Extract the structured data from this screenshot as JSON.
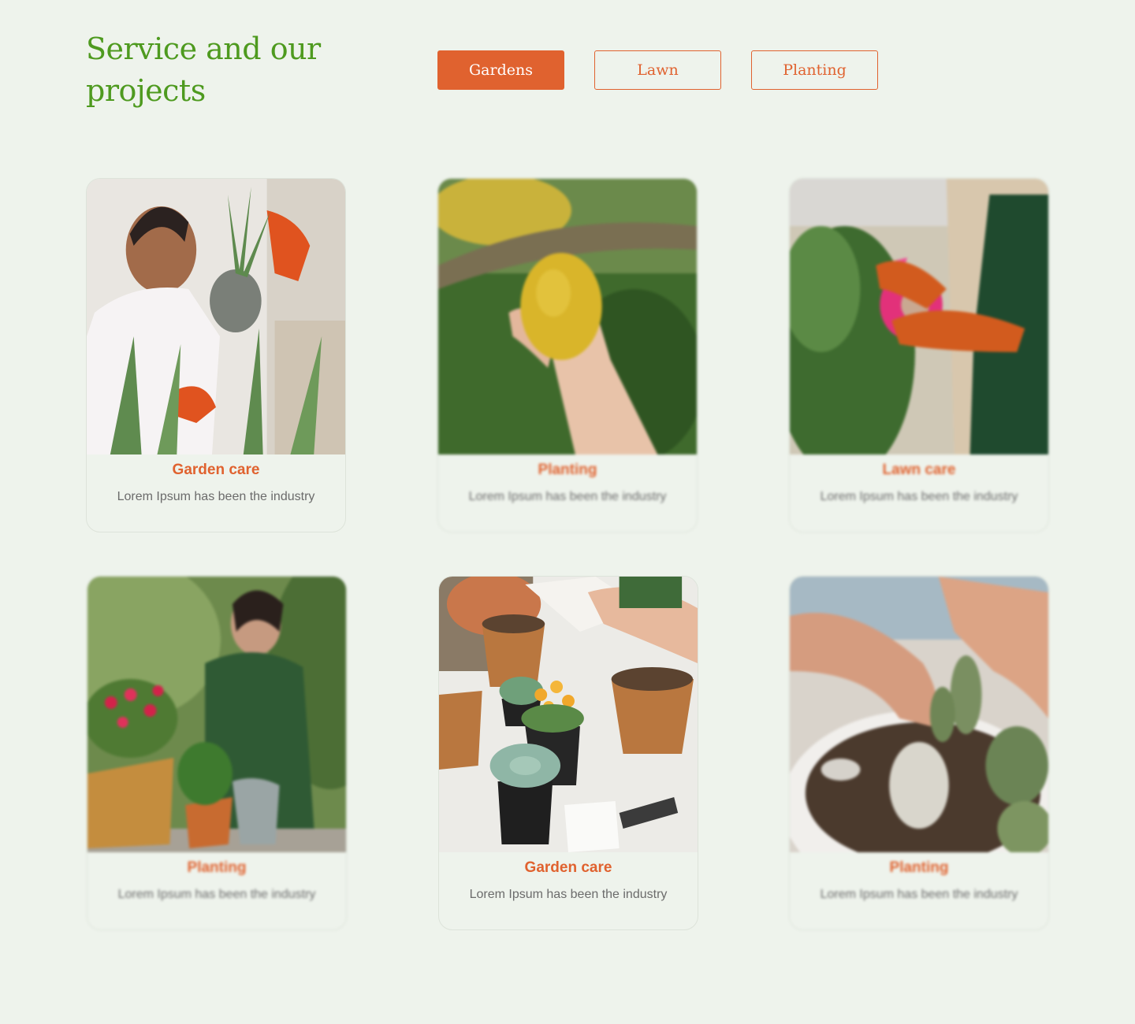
{
  "header": {
    "title": "Service and our projects"
  },
  "filters": [
    {
      "label": "Gardens",
      "active": true
    },
    {
      "label": "Lawn",
      "active": false
    },
    {
      "label": "Planting",
      "active": false
    }
  ],
  "cards": [
    {
      "title": "Garden care",
      "description": "Lorem Ipsum has been the industry",
      "image": "woman-with-aloe-plant-photo",
      "dimmed": false
    },
    {
      "title": "Planting",
      "description": "Lorem Ipsum has been the industry",
      "image": "hand-holding-lemon-photo",
      "dimmed": true
    },
    {
      "title": "Lawn care",
      "description": "Lorem Ipsum has been the industry",
      "image": "gloved-hands-spraying-plant-photo",
      "dimmed": true
    },
    {
      "title": "Planting",
      "description": "Lorem Ipsum has been the industry",
      "image": "woman-potting-roses-photo",
      "dimmed": true
    },
    {
      "title": "Garden care",
      "description": "Lorem Ipsum has been the industry",
      "image": "succulent-pots-table-photo",
      "dimmed": false
    },
    {
      "title": "Planting",
      "description": "Lorem Ipsum has been the industry",
      "image": "hands-planting-cactus-photo",
      "dimmed": true
    }
  ],
  "colors": {
    "background": "#eef3ec",
    "title_green": "#4e9a1f",
    "accent_orange": "#e0622f",
    "text_gray": "#6b6b6b"
  }
}
